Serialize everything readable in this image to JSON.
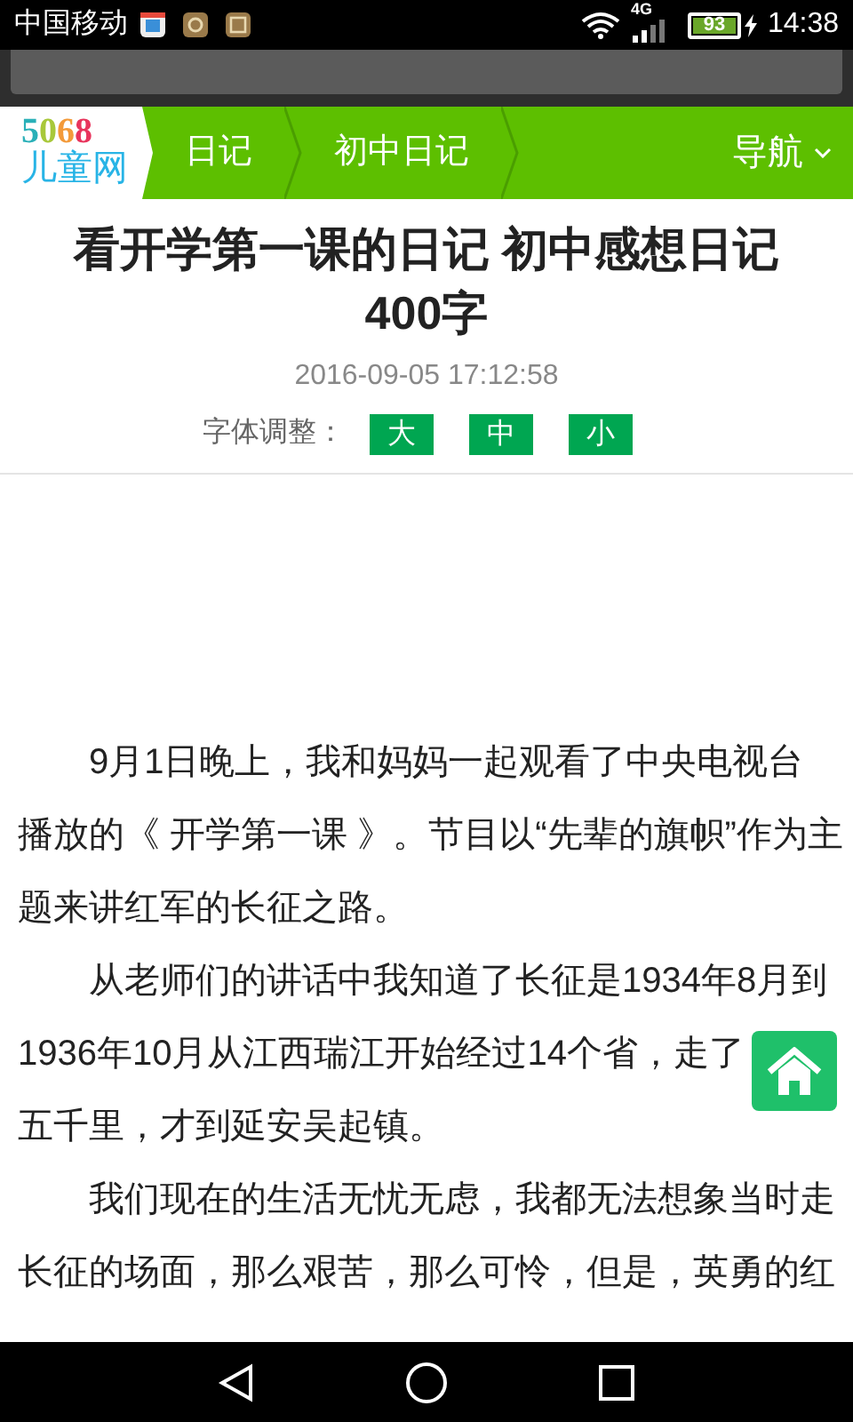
{
  "status_bar": {
    "carrier": "中国移动",
    "network": "4G",
    "battery": "93",
    "time": "14:38"
  },
  "header": {
    "logo": {
      "number": "5068",
      "name": "儿童网"
    },
    "breadcrumbs": [
      {
        "label": "日记"
      },
      {
        "label": "初中日记"
      }
    ],
    "nav_menu": {
      "label": "导航"
    }
  },
  "article": {
    "title": "看开学第一课的日记 初中感想日记400字",
    "date": "2016-09-05 17:12:58",
    "font_size": {
      "label": "字体调整：",
      "options": [
        {
          "label": "大"
        },
        {
          "label": "中"
        },
        {
          "label": "小"
        }
      ]
    },
    "paragraphs": [
      {
        "lines": [
          "9月1日晚上，我和妈妈一起观看了中央电视台",
          "播放的《 开学第一课 》。节目以“先辈的旗帜”作为主",
          "题来讲红军的长征之路。"
        ]
      },
      {
        "lines": [
          "从老师们的讲话中我知道了长征是1934年8月到",
          "1936年10月从江西瑞江开始经过14个省，走了",
          "五千里，才到延安吴起镇。"
        ]
      },
      {
        "lines": [
          "我们现在的生活无忧无虑，我都无法想象当时走",
          "长征的场面，那么艰苦，那么可怜，但是，英勇的红"
        ]
      }
    ]
  }
}
